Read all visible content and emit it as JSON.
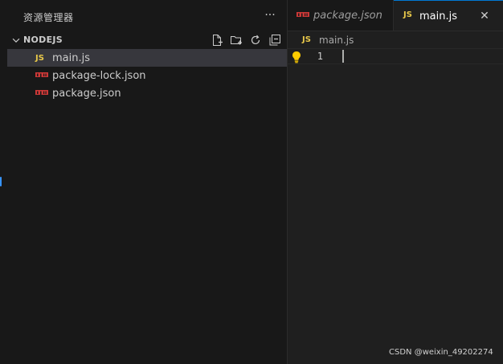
{
  "sidebar": {
    "title": "资源管理器",
    "more_label": "···",
    "section": {
      "title": "NODEJS",
      "actions": [
        {
          "icon": "new-file-icon"
        },
        {
          "icon": "new-folder-icon"
        },
        {
          "icon": "refresh-icon"
        },
        {
          "icon": "collapse-all-icon"
        }
      ]
    },
    "files": [
      {
        "name": "main.js",
        "icon": "js-file-icon",
        "icon_text": "JS",
        "selected": true
      },
      {
        "name": "package-lock.json",
        "icon": "npm-json-icon",
        "selected": false
      },
      {
        "name": "package.json",
        "icon": "npm-json-icon",
        "selected": false
      }
    ]
  },
  "editor": {
    "tabs": [
      {
        "label": "package.json",
        "icon": "npm-json-icon",
        "active": false
      },
      {
        "label": "main.js",
        "icon": "js-file-icon",
        "icon_text": "JS",
        "active": true,
        "close_label": "✕"
      }
    ],
    "breadcrumb": {
      "icon_text": "JS",
      "label": "main.js"
    },
    "lines": [
      {
        "number": "1",
        "text": ""
      }
    ]
  },
  "watermark": "CSDN @weixin_49202274",
  "colors": {
    "background": "#1f1f1f",
    "sidebar": "#181818",
    "selected_row": "#37373d",
    "js_yellow": "#e8c84a",
    "npm_red": "#cb3837",
    "accent": "#0078d4",
    "bulb": "#ffcc00"
  }
}
